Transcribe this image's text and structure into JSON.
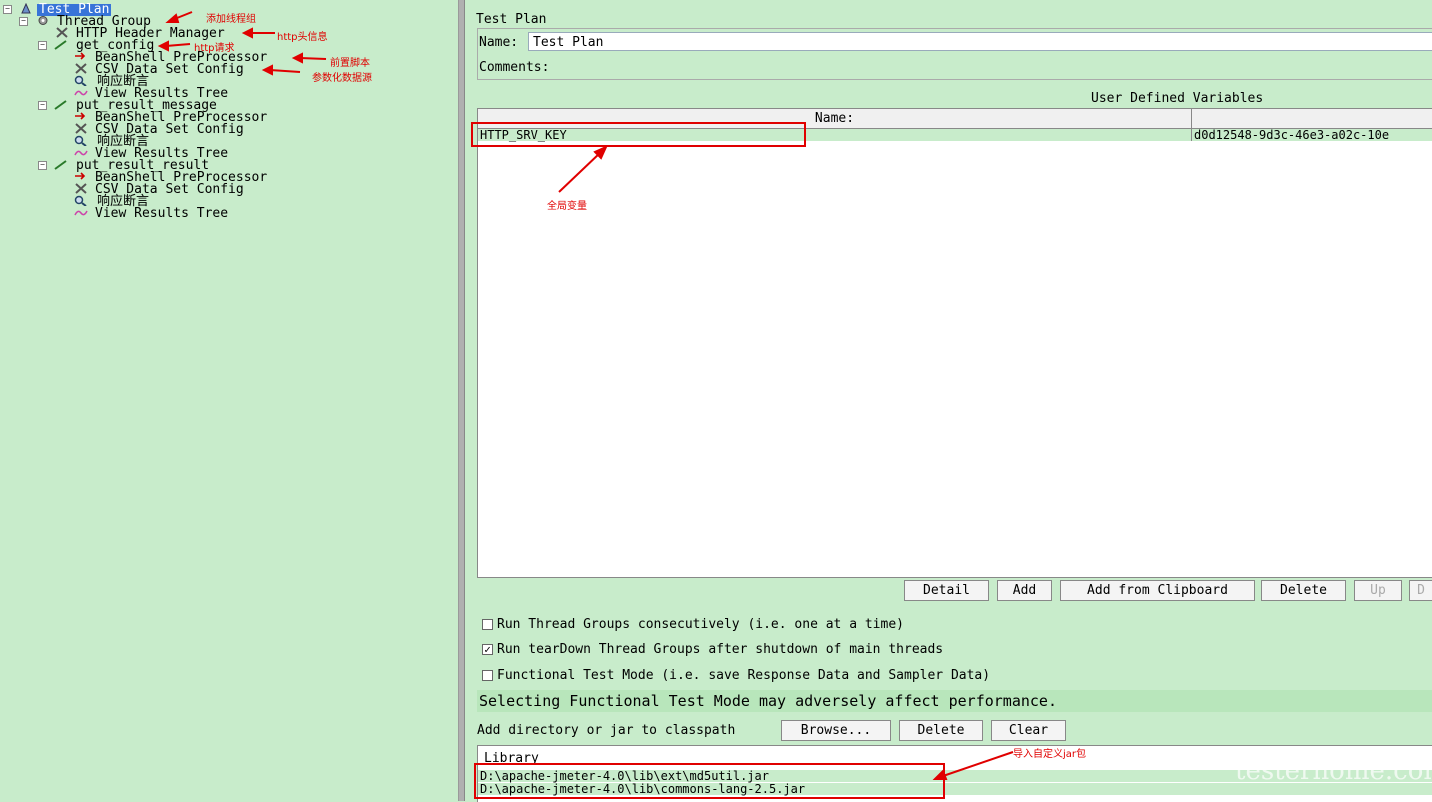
{
  "tree": {
    "root": "Test Plan",
    "thread_group": "Thread Group",
    "header_manager": "HTTP Header Manager",
    "sampler1": "get_config",
    "sampler2": "put_result_message",
    "sampler3": "put_result_result",
    "beanshell": "BeanShell PreProcessor",
    "csv": "CSV Data Set Config",
    "assertion": "响应断言",
    "results_tree": "View Results Tree"
  },
  "annotations": {
    "add_thread_group": "添加线程组",
    "http_header": "http头信息",
    "http_request": "http请求",
    "pre_script": "前置脚本",
    "param_source": "参数化数据源",
    "global_var": "全局变量",
    "import_jar": "导入自定义jar包"
  },
  "panel": {
    "title": "Test Plan",
    "name_label": "Name:",
    "name_value": "Test Plan",
    "comments_label": "Comments:",
    "udv_title": "User Defined Variables",
    "col_name": "Name:",
    "var_name": "HTTP_SRV_KEY",
    "var_value": "d0d12548-9d3c-46e3-a02c-10e"
  },
  "buttons": {
    "detail": "Detail",
    "add": "Add",
    "add_clipboard": "Add from Clipboard",
    "delete": "Delete",
    "up": "Up",
    "down": "D",
    "browse": "Browse...",
    "delete2": "Delete",
    "clear": "Clear"
  },
  "options": {
    "opt1": "Run Thread Groups consecutively (i.e. one at a time)",
    "opt1_checked": false,
    "opt2": "Run tearDown Thread Groups after shutdown of main threads",
    "opt2_checked": true,
    "opt3": "Functional Test Mode (i.e. save Response Data and Sampler Data)",
    "opt3_checked": false,
    "warning": "Selecting Functional Test Mode may adversely affect performance."
  },
  "classpath": {
    "label": "Add directory or jar to classpath",
    "library_header": "Library",
    "jars": [
      "D:\\apache-jmeter-4.0\\lib\\ext\\md5util.jar",
      "D:\\apache-jmeter-4.0\\lib\\commons-lang-2.5.jar"
    ]
  },
  "watermark": "testerhome.com",
  "colors": {
    "panel_bg": "#c8eccb",
    "annotation": "#e00000",
    "selection": "#3874d8"
  }
}
